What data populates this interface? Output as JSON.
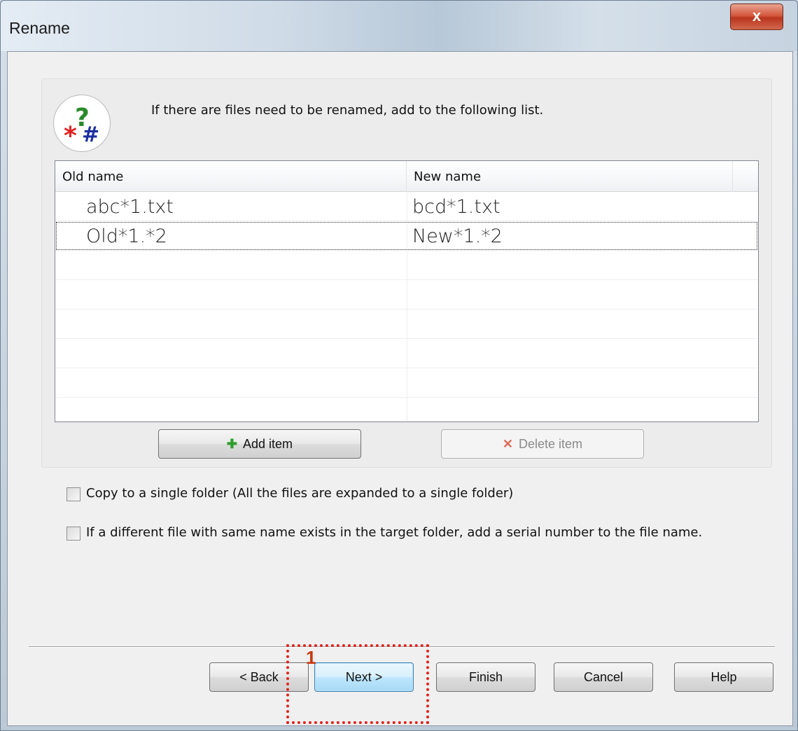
{
  "window": {
    "title": "Rename",
    "close_glyph": "x"
  },
  "header": {
    "instruction": "If there are files need to be renamed, add to the following list."
  },
  "list": {
    "columns": [
      "Old name",
      "New name"
    ],
    "rows": [
      {
        "old": "abc*1.txt",
        "new": "bcd*1.txt"
      },
      {
        "old": "Old*1.*2",
        "new": "New*1.*2"
      }
    ],
    "selected_row": 1
  },
  "list_buttons": {
    "add_label": "Add item",
    "add_icon": "plus-icon",
    "delete_label": "Delete item",
    "delete_icon": "cross-icon"
  },
  "options": {
    "copy_single_folder": {
      "label": "Copy to a single folder (All the files are expanded to a single folder)",
      "checked": false
    },
    "serial_number": {
      "label": "If a different file with same name exists in the target folder, add a serial number to the file name.",
      "checked": false
    }
  },
  "footer": {
    "back_label": "< Back",
    "next_label": "Next >",
    "finish_label": "Finish",
    "cancel_label": "Cancel",
    "help_label": "Help"
  },
  "annotation": {
    "number": "1"
  },
  "colors": {
    "add_icon": "#2e9e2e",
    "delete_icon": "#e06a5a",
    "annotation": "#e2231a"
  }
}
